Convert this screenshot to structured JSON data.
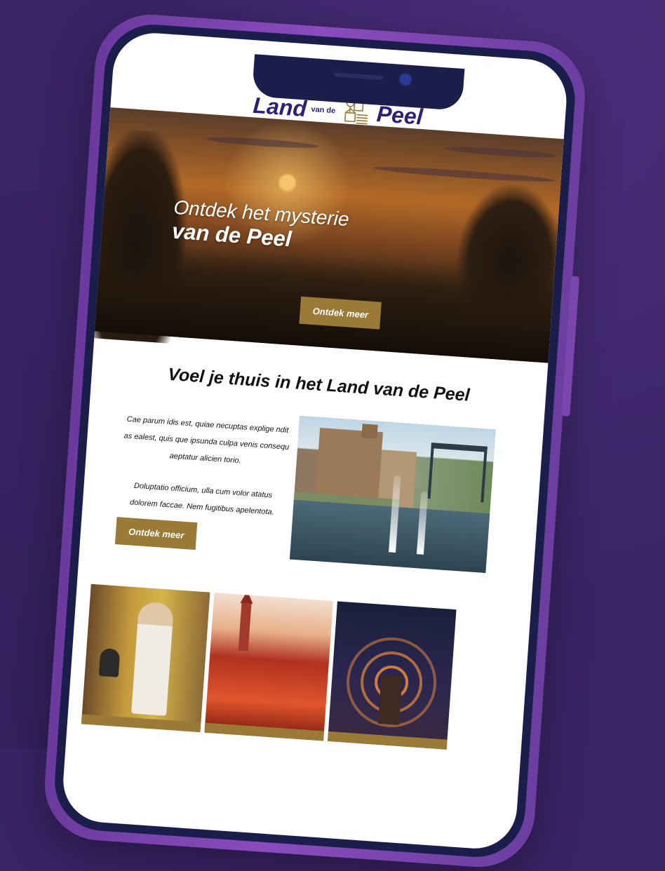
{
  "logo": {
    "land": "Land",
    "vande": "van de",
    "peel": "Peel"
  },
  "hero": {
    "title_line1": "Ontdek het mysterie",
    "title_line2": "van de Peel",
    "button": "Ontdek meer"
  },
  "intro": {
    "heading": "Voel je thuis in het Land van de Peel",
    "paragraph1": "Cae parum idis est, quiae necuptas explige ndit as ealest, quis que ipsunda culpa venis consequ aeptatur alicien torio.",
    "paragraph2": "Doluptatio officium, ulla cum volor atatus dolorem faccae. Nem fugitibus apelentota.",
    "button": "Ontdek meer"
  },
  "colors": {
    "background": "#3a2466",
    "phone_frame": "#7b45ae",
    "accent_gold": "#9a7a36",
    "logo_text": "#2c1f78"
  }
}
